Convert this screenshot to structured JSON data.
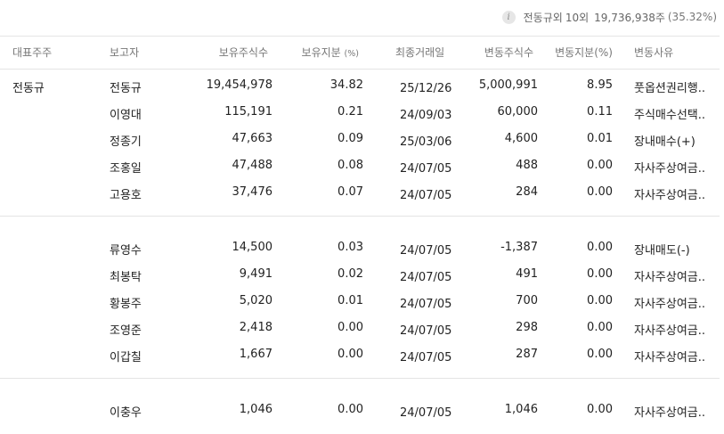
{
  "summary": {
    "holder": "전동규외",
    "count": "10외",
    "shares": "19,736,938주",
    "percent": "(35.32%)"
  },
  "header": {
    "major": "대표주주",
    "reporter": "보고자",
    "shares": "보유주식수",
    "ratio": "보유지분",
    "ratio_unit": "(%)",
    "last_date": "최종거래일",
    "change_shares": "변동주식수",
    "change_pct": "변동지분(%)",
    "reason": "변동사유"
  },
  "groups": [
    {
      "major": "전동규",
      "rows": [
        {
          "reporter": "전동규",
          "shares": "19,454,978",
          "ratio": "34.82",
          "date": "25/12/26",
          "change": "5,000,991",
          "change_pct": "8.95",
          "reason": "풋옵션권리행.."
        },
        {
          "reporter": "이영대",
          "shares": "115,191",
          "ratio": "0.21",
          "date": "24/09/03",
          "change": "60,000",
          "change_pct": "0.11",
          "reason": "주식매수선택.."
        },
        {
          "reporter": "정종기",
          "shares": "47,663",
          "ratio": "0.09",
          "date": "25/03/06",
          "change": "4,600",
          "change_pct": "0.01",
          "reason": "장내매수(+)"
        },
        {
          "reporter": "조홍일",
          "shares": "47,488",
          "ratio": "0.08",
          "date": "24/07/05",
          "change": "488",
          "change_pct": "0.00",
          "reason": "자사주상여금.."
        },
        {
          "reporter": "고용호",
          "shares": "37,476",
          "ratio": "0.07",
          "date": "24/07/05",
          "change": "284",
          "change_pct": "0.00",
          "reason": "자사주상여금.."
        }
      ]
    },
    {
      "major": "",
      "rows": [
        {
          "reporter": "류영수",
          "shares": "14,500",
          "ratio": "0.03",
          "date": "24/07/05",
          "change": "-1,387",
          "change_pct": "0.00",
          "reason": "장내매도(-)"
        },
        {
          "reporter": "최봉탁",
          "shares": "9,491",
          "ratio": "0.02",
          "date": "24/07/05",
          "change": "491",
          "change_pct": "0.00",
          "reason": "자사주상여금.."
        },
        {
          "reporter": "황봉주",
          "shares": "5,020",
          "ratio": "0.01",
          "date": "24/07/05",
          "change": "700",
          "change_pct": "0.00",
          "reason": "자사주상여금.."
        },
        {
          "reporter": "조영준",
          "shares": "2,418",
          "ratio": "0.00",
          "date": "24/07/05",
          "change": "298",
          "change_pct": "0.00",
          "reason": "자사주상여금.."
        },
        {
          "reporter": "이갑칠",
          "shares": "1,667",
          "ratio": "0.00",
          "date": "24/07/05",
          "change": "287",
          "change_pct": "0.00",
          "reason": "자사주상여금.."
        }
      ]
    },
    {
      "major": "",
      "rows": [
        {
          "reporter": "이충우",
          "shares": "1,046",
          "ratio": "0.00",
          "date": "24/07/05",
          "change": "1,046",
          "change_pct": "0.00",
          "reason": "자사주상여금.."
        }
      ]
    }
  ]
}
